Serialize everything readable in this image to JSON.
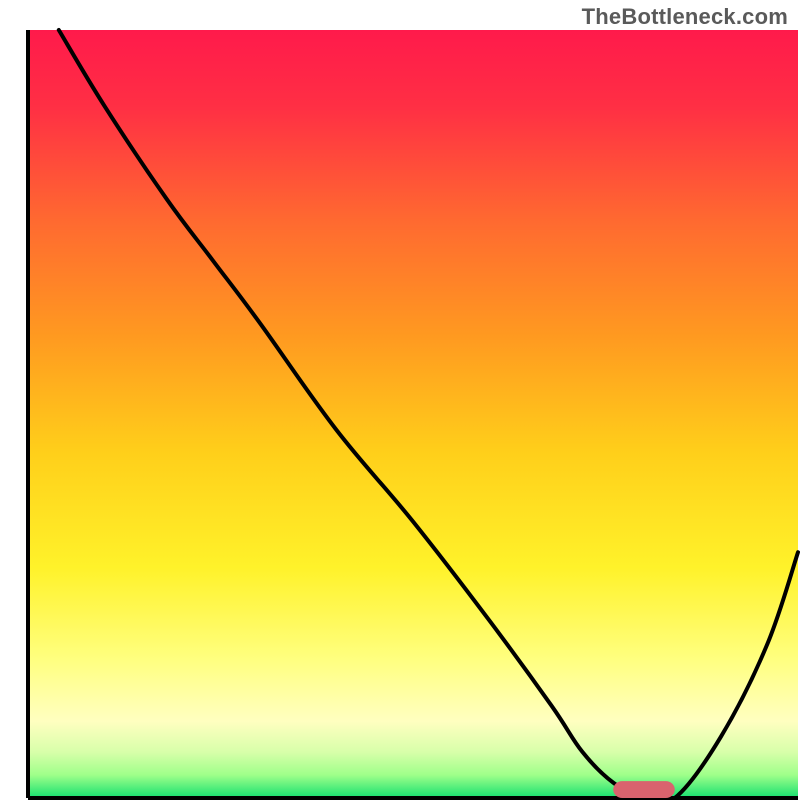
{
  "watermark": "TheBottleneck.com",
  "chart_data": {
    "type": "line",
    "title": "",
    "xlabel": "",
    "ylabel": "",
    "xlim": [
      0,
      100
    ],
    "ylim": [
      0,
      100
    ],
    "grid": false,
    "legend": false,
    "gradient_stops": [
      {
        "offset": 0.0,
        "color": "#ff1a4b"
      },
      {
        "offset": 0.1,
        "color": "#ff2f44"
      },
      {
        "offset": 0.25,
        "color": "#ff6a30"
      },
      {
        "offset": 0.4,
        "color": "#ff9a20"
      },
      {
        "offset": 0.55,
        "color": "#ffcf1a"
      },
      {
        "offset": 0.7,
        "color": "#fff22a"
      },
      {
        "offset": 0.82,
        "color": "#ffff80"
      },
      {
        "offset": 0.9,
        "color": "#ffffc0"
      },
      {
        "offset": 0.94,
        "color": "#d8ffaa"
      },
      {
        "offset": 0.97,
        "color": "#9fff8a"
      },
      {
        "offset": 1.0,
        "color": "#15e070"
      }
    ],
    "series": [
      {
        "name": "bottleneck-curve",
        "color": "#000000",
        "x": [
          4,
          10,
          18,
          24,
          30,
          40,
          50,
          60,
          68,
          72,
          76,
          80,
          84,
          90,
          96,
          100
        ],
        "y": [
          100,
          90,
          78,
          70,
          62,
          48,
          36,
          23,
          12,
          6,
          2,
          0,
          0,
          8,
          20,
          32
        ]
      }
    ],
    "marker": {
      "name": "optimal-range",
      "color": "#d9636e",
      "x_start": 76,
      "x_end": 84,
      "y": 0,
      "thickness": 2.2
    },
    "axes": {
      "left": {
        "x": 3.5,
        "y0": 3.5,
        "y1": 100
      },
      "bottom": {
        "y": 100,
        "x0": 3.5,
        "x1": 100
      }
    }
  }
}
